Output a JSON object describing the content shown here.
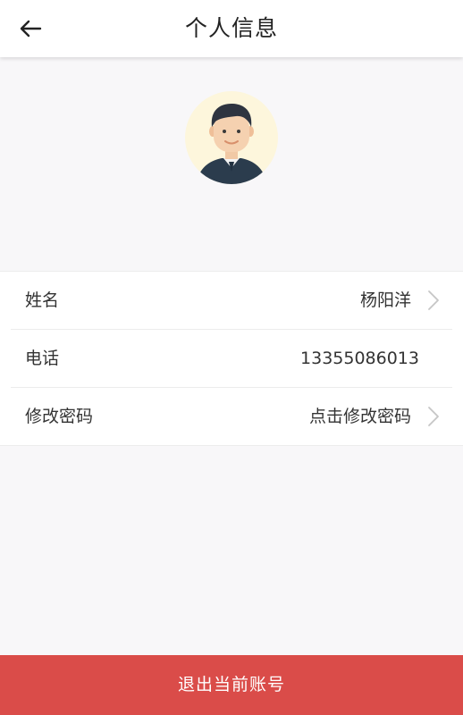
{
  "header": {
    "back_icon": "arrow-left-icon",
    "title": "个人信息"
  },
  "profile": {
    "avatar_icon": "user-avatar-icon",
    "avatar_bg": "#fdf6dc"
  },
  "info": {
    "rows": [
      {
        "label": "姓名",
        "value": "杨阳洋",
        "has_arrow": true
      },
      {
        "label": "电话",
        "value": "13355086013",
        "has_arrow": false
      },
      {
        "label": "修改密码",
        "value": "点击修改密码",
        "has_arrow": true
      }
    ],
    "chevron_icon": "chevron-right-icon"
  },
  "footer": {
    "logout_label": "退出当前账号",
    "accent_color": "#da4c49"
  }
}
